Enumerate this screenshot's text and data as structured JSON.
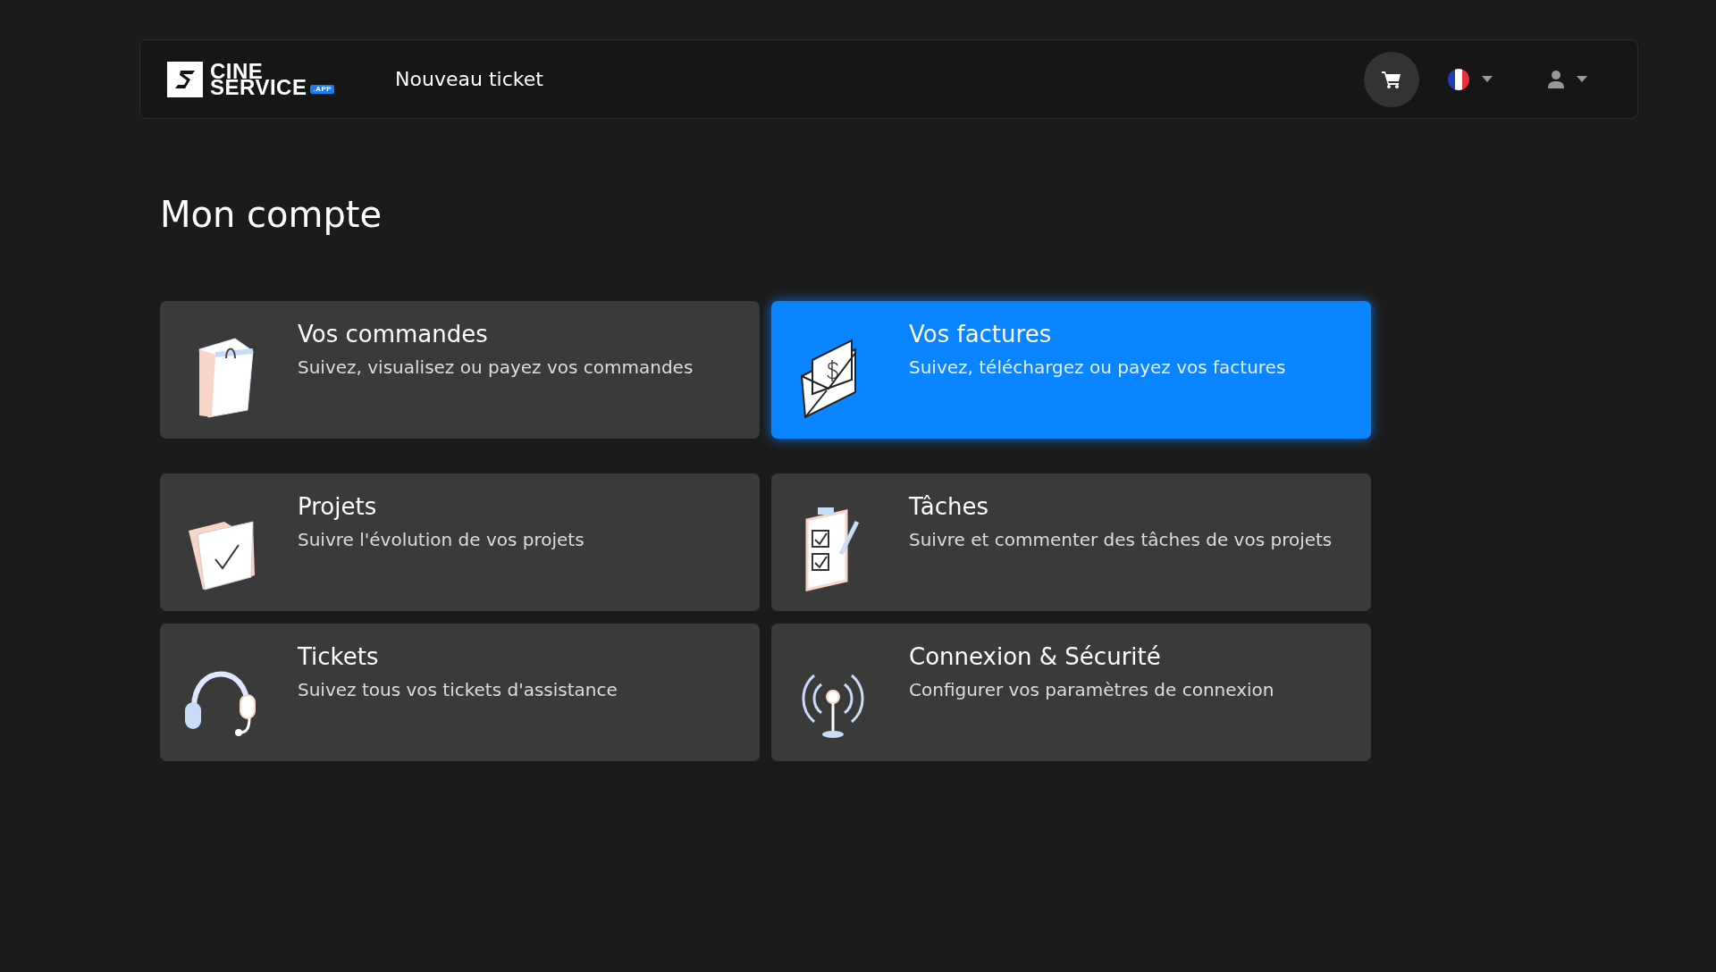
{
  "header": {
    "logo": {
      "line_1": "CINE",
      "line_2": "SERVICE",
      "badge": ".APP"
    },
    "link": "Nouveau ticket"
  },
  "page_title": "Mon compte",
  "cards": [
    {
      "kind": "bag",
      "title": "Vos commandes",
      "subtitle": "Suivez, visualisez ou payez vos commandes",
      "selected": false
    },
    {
      "kind": "invoice",
      "title": "Vos factures",
      "subtitle": "Suivez, téléchargez ou payez vos factures",
      "selected": true
    },
    {
      "kind": "folder",
      "title": "Projets",
      "subtitle": "Suivre l'évolution de vos projets",
      "selected": false
    },
    {
      "kind": "clipboard",
      "title": "Tâches",
      "subtitle": "Suivre et commenter des tâches de vos projets",
      "selected": false
    },
    {
      "kind": "headset",
      "title": "Tickets",
      "subtitle": "Suivez tous vos tickets d'assistance",
      "selected": false
    },
    {
      "kind": "antenna",
      "title": "Connexion & Sécurité",
      "subtitle": "Configurer vos paramètres de connexion",
      "selected": false
    }
  ]
}
